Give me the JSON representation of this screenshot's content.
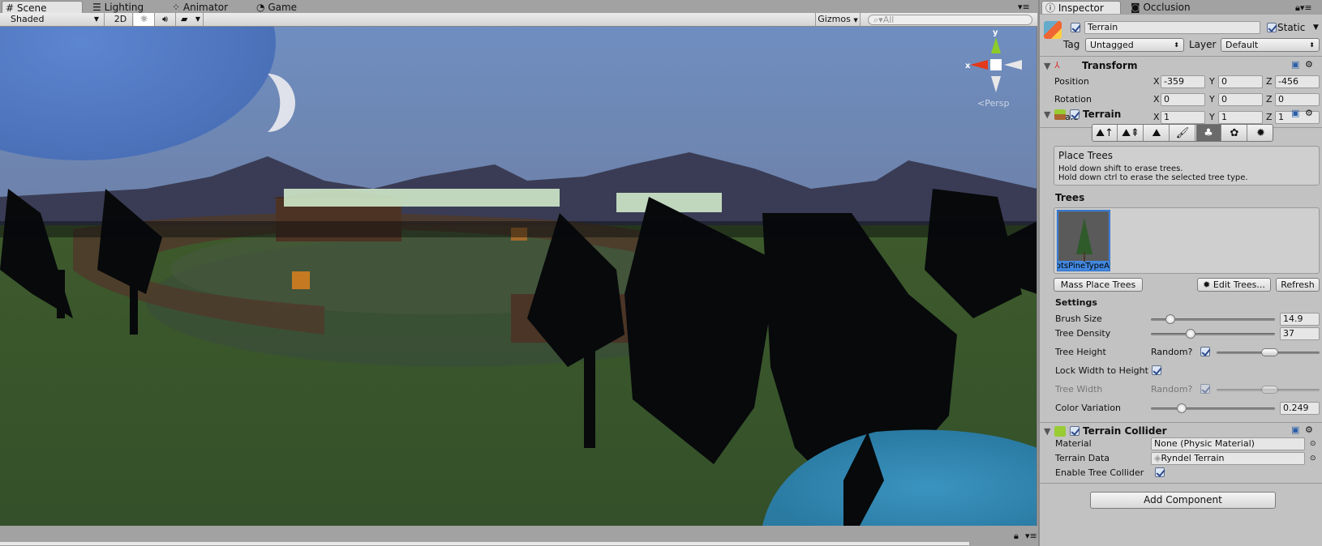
{
  "scene_tabs": [
    {
      "label": "Scene",
      "icon": "grid-icon"
    },
    {
      "label": "Lighting",
      "icon": "lighting-icon"
    },
    {
      "label": "Animator",
      "icon": "animator-icon"
    },
    {
      "label": "Game",
      "icon": "pacman-icon"
    }
  ],
  "scene_toolbar": {
    "draw_mode": "Shaded",
    "mode_2d": "2D",
    "gizmos": "Gizmos",
    "search_placeholder": "All"
  },
  "scene_view": {
    "projection": "Persp",
    "axis_x": "x",
    "axis_y": "y"
  },
  "inspector": {
    "tabs": [
      {
        "label": "Inspector",
        "icon": "info-icon"
      },
      {
        "label": "Occlusion",
        "icon": "occlusion-icon"
      }
    ],
    "object": {
      "active": true,
      "name": "Terrain",
      "static": true,
      "static_label": "Static",
      "tag_label": "Tag",
      "tag": "Untagged",
      "layer_label": "Layer",
      "layer": "Default"
    },
    "transform": {
      "title": "Transform",
      "rows": [
        {
          "label": "Position",
          "x": "-359",
          "y": "0",
          "z": "-456"
        },
        {
          "label": "Rotation",
          "x": "0",
          "y": "0",
          "z": "0"
        },
        {
          "label": "Scale",
          "x": "1",
          "y": "1",
          "z": "1"
        }
      ],
      "axis": {
        "x": "X",
        "y": "Y",
        "z": "Z"
      }
    },
    "terrain": {
      "title": "Terrain",
      "enabled": true,
      "tools": [
        "raise-lower-icon",
        "paint-height-icon",
        "smooth-height-icon",
        "paint-texture-icon",
        "place-trees-icon",
        "paint-details-icon",
        "settings-icon"
      ],
      "active_tool": 4,
      "help_title": "Place Trees",
      "help_line1": "Hold down shift to erase trees.",
      "help_line2": "Hold down ctrl to erase the selected tree type.",
      "trees_label": "Trees",
      "tree_item": "otsPineTypeA",
      "mass_place": "Mass Place Trees",
      "edit_trees": "Edit Trees...",
      "refresh": "Refresh",
      "settings_label": "Settings",
      "brush_size": {
        "label": "Brush Size",
        "value": "14.9",
        "fraction": 0.16
      },
      "tree_density": {
        "label": "Tree Density",
        "value": "37",
        "fraction": 0.32
      },
      "tree_height": {
        "label": "Tree Height",
        "random_label": "Random?",
        "random": true,
        "range": [
          0.43,
          0.6
        ]
      },
      "lock_width": {
        "label": "Lock Width to Height",
        "checked": true
      },
      "tree_width": {
        "label": "Tree Width",
        "random_label": "Random?",
        "random": true,
        "range": [
          0.43,
          0.6
        ]
      },
      "color_variation": {
        "label": "Color Variation",
        "value": "0.249",
        "fraction": 0.25
      }
    },
    "collider": {
      "title": "Terrain Collider",
      "enabled": true,
      "material_label": "Material",
      "material": "None (Physic Material)",
      "data_label": "Terrain Data",
      "data": "Ryndel Terrain",
      "tree_collider_label": "Enable Tree Collider",
      "tree_collider": true
    },
    "add_component": "Add Component"
  }
}
